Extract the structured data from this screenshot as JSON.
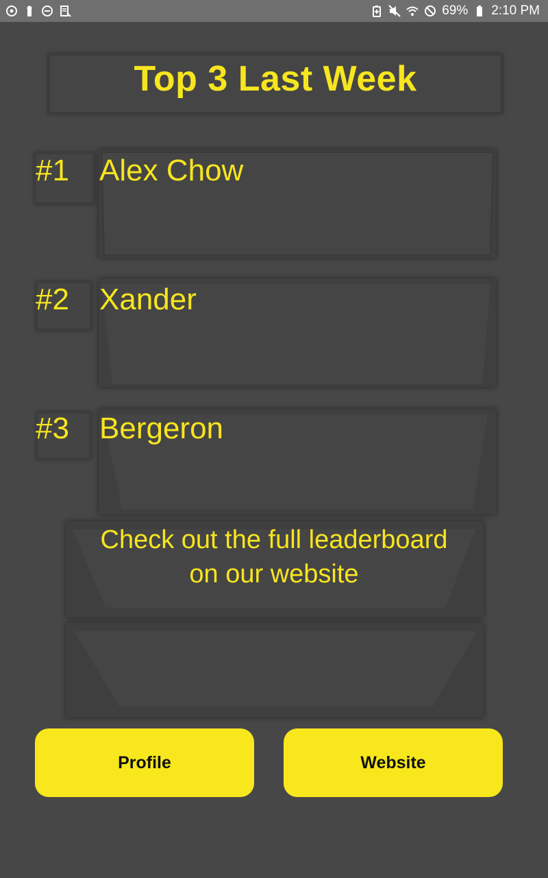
{
  "status_bar": {
    "battery": "69%",
    "time": "2:10 PM",
    "left_icons": [
      "sync-icon",
      "keyhole-icon",
      "minus-circle-icon",
      "document-icon"
    ],
    "right_icons": [
      "battery-saver-icon",
      "mute-icon",
      "wifi-icon",
      "blocked-icon",
      "battery-icon"
    ]
  },
  "title": "Top 3 Last Week",
  "ranks": [
    {
      "rank": "#1",
      "name": "Alex Chow"
    },
    {
      "rank": "#2",
      "name": "Xander"
    },
    {
      "rank": "#3",
      "name": "Bergeron"
    }
  ],
  "message": {
    "line1": "Check out the full leaderboard",
    "line2": "on our website"
  },
  "buttons": {
    "profile": "Profile",
    "website": "Website"
  },
  "colors": {
    "accent": "#f8e71c",
    "background": "#474747",
    "status_bar": "#6f6f6f"
  }
}
